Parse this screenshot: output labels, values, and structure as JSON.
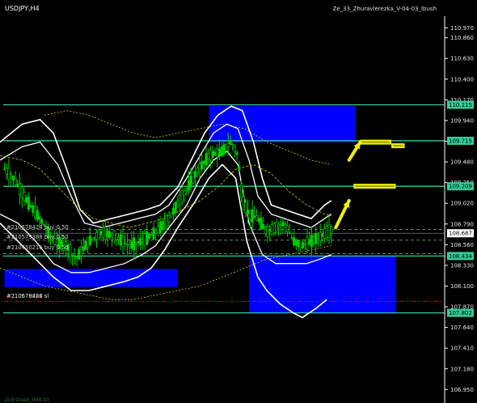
{
  "window": {
    "symbol": "USDJPY,H4",
    "indicator": "Ze_33_Zhuravlerezka_V-04-03_Ibush",
    "bottom_label": "ZL9 Grasli_V04-10"
  },
  "colors": {
    "background": "#000000",
    "candle": "#00cc00",
    "level_line": "#33cc99",
    "zone": "#0000ff",
    "band": "#ffffff",
    "ma": "#d4cc00",
    "order_line": "#cc0000",
    "arrow": "#f0f000",
    "current_price_tag": "#ffffff"
  },
  "orders": [
    {
      "label": "#210678424 buy 0.50"
    },
    {
      "label": "#210579388 buy 0.50"
    },
    {
      "label": "#210450216 buy 0.50"
    },
    {
      "label": "#210679388 sl"
    },
    {
      "label": "#210578424 sl"
    }
  ],
  "chart_data": {
    "type": "candlestick",
    "symbol": "USDJPY",
    "timeframe": "H4",
    "ylim": [
      106.8,
      111.1
    ],
    "y_ticks": [
      "110.970",
      "110.860",
      "110.630",
      "110.400",
      "110.170",
      "109.940",
      "109.710",
      "109.480",
      "109.250",
      "109.020",
      "108.790",
      "108.560",
      "108.330",
      "108.100",
      "107.870",
      "107.640",
      "107.410",
      "107.180",
      "106.950"
    ],
    "levels": [
      {
        "price": 110.115,
        "label": "110.115"
      },
      {
        "price": 109.715,
        "label": "109.715"
      },
      {
        "price": 109.209,
        "label": "109.209"
      },
      {
        "price": 108.434,
        "label": "108.434"
      },
      {
        "price": 107.802,
        "label": "107.802"
      }
    ],
    "current_price": {
      "price": 108.687,
      "label": "108.687"
    },
    "zones": [
      {
        "x0": 0.47,
        "x1": 0.8,
        "y0": 109.7,
        "y1": 110.1
      },
      {
        "x0": 0.01,
        "x1": 0.4,
        "y0": 108.09,
        "y1": 108.29
      },
      {
        "x0": 0.56,
        "x1": 0.89,
        "y0": 107.8,
        "y1": 108.44
      }
    ],
    "order_lines": [
      108.73,
      108.61,
      108.46,
      107.93
    ],
    "close_path": [
      [
        0.0,
        109.45
      ],
      [
        0.03,
        109.3
      ],
      [
        0.06,
        109.05
      ],
      [
        0.09,
        108.85
      ],
      [
        0.12,
        108.6
      ],
      [
        0.15,
        108.55
      ],
      [
        0.17,
        108.4
      ],
      [
        0.2,
        108.6
      ],
      [
        0.23,
        108.7
      ],
      [
        0.26,
        108.65
      ],
      [
        0.29,
        108.55
      ],
      [
        0.32,
        108.6
      ],
      [
        0.35,
        108.7
      ],
      [
        0.38,
        108.85
      ],
      [
        0.41,
        109.1
      ],
      [
        0.44,
        109.35
      ],
      [
        0.47,
        109.55
      ],
      [
        0.5,
        109.6
      ],
      [
        0.52,
        109.7
      ],
      [
        0.535,
        109.55
      ],
      [
        0.545,
        109.05
      ],
      [
        0.56,
        108.9
      ],
      [
        0.58,
        108.85
      ],
      [
        0.6,
        108.7
      ],
      [
        0.62,
        108.75
      ],
      [
        0.64,
        108.8
      ],
      [
        0.66,
        108.6
      ],
      [
        0.68,
        108.55
      ],
      [
        0.7,
        108.6
      ],
      [
        0.72,
        108.65
      ],
      [
        0.735,
        108.7
      ],
      [
        0.745,
        108.72
      ]
    ],
    "upper_band": [
      [
        0.0,
        109.7
      ],
      [
        0.05,
        109.9
      ],
      [
        0.09,
        109.95
      ],
      [
        0.12,
        109.8
      ],
      [
        0.15,
        109.4
      ],
      [
        0.18,
        108.95
      ],
      [
        0.21,
        108.8
      ],
      [
        0.25,
        108.85
      ],
      [
        0.29,
        108.9
      ],
      [
        0.33,
        108.95
      ],
      [
        0.36,
        109.0
      ],
      [
        0.4,
        109.2
      ],
      [
        0.43,
        109.5
      ],
      [
        0.46,
        109.8
      ],
      [
        0.49,
        110.0
      ],
      [
        0.52,
        110.1
      ],
      [
        0.545,
        110.05
      ],
      [
        0.57,
        109.7
      ],
      [
        0.59,
        109.3
      ],
      [
        0.61,
        109.0
      ],
      [
        0.64,
        108.95
      ],
      [
        0.67,
        108.9
      ],
      [
        0.7,
        108.85
      ],
      [
        0.73,
        109.0
      ],
      [
        0.745,
        109.05
      ]
    ],
    "upper_inner": [
      [
        0.0,
        109.5
      ],
      [
        0.05,
        109.65
      ],
      [
        0.09,
        109.7
      ],
      [
        0.13,
        109.45
      ],
      [
        0.16,
        109.1
      ],
      [
        0.19,
        108.8
      ],
      [
        0.23,
        108.75
      ],
      [
        0.27,
        108.8
      ],
      [
        0.31,
        108.85
      ],
      [
        0.35,
        108.9
      ],
      [
        0.38,
        109.0
      ],
      [
        0.42,
        109.3
      ],
      [
        0.45,
        109.55
      ],
      [
        0.48,
        109.8
      ],
      [
        0.51,
        109.9
      ],
      [
        0.535,
        109.85
      ],
      [
        0.56,
        109.5
      ],
      [
        0.58,
        109.1
      ],
      [
        0.61,
        108.9
      ],
      [
        0.64,
        108.85
      ],
      [
        0.67,
        108.8
      ],
      [
        0.7,
        108.75
      ],
      [
        0.745,
        108.9
      ]
    ],
    "lower_inner": [
      [
        0.0,
        108.9
      ],
      [
        0.04,
        108.8
      ],
      [
        0.08,
        108.6
      ],
      [
        0.12,
        108.35
      ],
      [
        0.16,
        108.25
      ],
      [
        0.2,
        108.25
      ],
      [
        0.24,
        108.3
      ],
      [
        0.28,
        108.35
      ],
      [
        0.32,
        108.45
      ],
      [
        0.35,
        108.55
      ],
      [
        0.38,
        108.75
      ],
      [
        0.42,
        109.0
      ],
      [
        0.45,
        109.3
      ],
      [
        0.48,
        109.5
      ],
      [
        0.51,
        109.6
      ],
      [
        0.535,
        109.45
      ],
      [
        0.56,
        108.8
      ],
      [
        0.59,
        108.45
      ],
      [
        0.62,
        108.35
      ],
      [
        0.66,
        108.35
      ],
      [
        0.69,
        108.35
      ],
      [
        0.72,
        108.4
      ],
      [
        0.745,
        108.45
      ]
    ],
    "lower_band": [
      [
        0.0,
        108.8
      ],
      [
        0.04,
        108.6
      ],
      [
        0.08,
        108.4
      ],
      [
        0.12,
        108.2
      ],
      [
        0.16,
        108.05
      ],
      [
        0.2,
        108.05
      ],
      [
        0.24,
        108.1
      ],
      [
        0.28,
        108.15
      ],
      [
        0.31,
        108.2
      ],
      [
        0.34,
        108.3
      ],
      [
        0.37,
        108.5
      ],
      [
        0.4,
        108.75
      ],
      [
        0.44,
        109.05
      ],
      [
        0.47,
        109.3
      ],
      [
        0.5,
        109.45
      ],
      [
        0.53,
        109.3
      ],
      [
        0.555,
        108.6
      ],
      [
        0.58,
        108.2
      ],
      [
        0.6,
        108.05
      ],
      [
        0.63,
        107.9
      ],
      [
        0.66,
        107.8
      ],
      [
        0.68,
        107.75
      ],
      [
        0.71,
        107.85
      ],
      [
        0.735,
        107.95
      ]
    ],
    "ma_slow": [
      [
        0.0,
        109.55
      ],
      [
        0.05,
        109.5
      ],
      [
        0.09,
        109.4
      ],
      [
        0.13,
        109.2
      ],
      [
        0.17,
        109.0
      ],
      [
        0.21,
        108.85
      ],
      [
        0.25,
        108.8
      ],
      [
        0.29,
        108.75
      ],
      [
        0.33,
        108.8
      ],
      [
        0.37,
        108.85
      ],
      [
        0.41,
        108.95
      ],
      [
        0.45,
        109.05
      ],
      [
        0.49,
        109.2
      ],
      [
        0.53,
        109.4
      ],
      [
        0.57,
        109.45
      ],
      [
        0.61,
        109.35
      ],
      [
        0.65,
        109.15
      ],
      [
        0.69,
        109.0
      ],
      [
        0.73,
        108.9
      ],
      [
        0.745,
        108.88
      ]
    ],
    "ma_top": [
      [
        0.1,
        110.0
      ],
      [
        0.15,
        110.05
      ],
      [
        0.2,
        110.0
      ],
      [
        0.25,
        109.9
      ],
      [
        0.3,
        109.8
      ],
      [
        0.35,
        109.75
      ],
      [
        0.4,
        109.8
      ],
      [
        0.45,
        109.85
      ],
      [
        0.5,
        109.9
      ],
      [
        0.55,
        109.85
      ],
      [
        0.6,
        109.7
      ],
      [
        0.65,
        109.6
      ],
      [
        0.7,
        109.5
      ],
      [
        0.745,
        109.45
      ]
    ],
    "ma_bottom": [
      [
        0.0,
        108.3
      ],
      [
        0.05,
        108.2
      ],
      [
        0.1,
        108.1
      ],
      [
        0.15,
        108.05
      ],
      [
        0.2,
        108.0
      ],
      [
        0.25,
        107.95
      ],
      [
        0.3,
        107.95
      ],
      [
        0.35,
        108.0
      ],
      [
        0.4,
        108.05
      ],
      [
        0.45,
        108.1
      ],
      [
        0.5,
        108.2
      ],
      [
        0.55,
        108.3
      ],
      [
        0.6,
        108.4
      ],
      [
        0.65,
        108.45
      ],
      [
        0.7,
        108.5
      ],
      [
        0.745,
        108.55
      ]
    ],
    "projection_arrows": [
      {
        "from": [
          0.755,
          108.75
        ],
        "to": [
          0.785,
          109.05
        ]
      },
      {
        "from": [
          0.785,
          109.5
        ],
        "to": [
          0.81,
          109.7
        ]
      }
    ],
    "projection_bars": [
      {
        "x0": 0.795,
        "x1": 0.89,
        "price": 109.21
      },
      {
        "x0": 0.81,
        "x1": 0.88,
        "price": 109.7
      },
      {
        "x0": 0.88,
        "x1": 0.91,
        "price": 109.66
      }
    ]
  }
}
